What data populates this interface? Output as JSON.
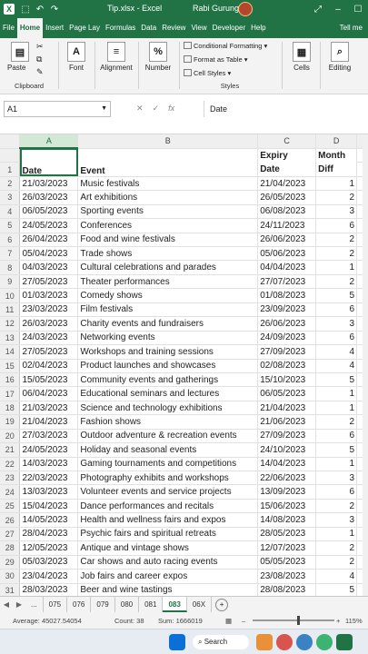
{
  "titlebar": {
    "autosave": "⬚",
    "undo": "↶",
    "redo": "↷",
    "title": "Tip.xlsx  -  Excel",
    "user": "Rabi Gurung",
    "controls": [
      "⤢",
      "–",
      "☐"
    ]
  },
  "tabs": [
    "File",
    "Home",
    "Insert",
    "Page Lay",
    "Formulas",
    "Data",
    "Review",
    "View",
    "Developer",
    "Help"
  ],
  "tellme": "Tell me",
  "ribbon": {
    "clipboard": {
      "paste": "Paste",
      "group": "Clipboard"
    },
    "font": "Font",
    "alignment": "Alignment",
    "number": "Number",
    "styles": {
      "cf": "Conditional Formatting",
      "ft": "Format as Table",
      "cs": "Cell Styles",
      "group": "Styles"
    },
    "cells": "Cells",
    "editing": "Editing"
  },
  "formula_bar": {
    "namebox": "A1",
    "fx": "fx",
    "content": "Date"
  },
  "columns": [
    "A",
    "B",
    "C",
    "D"
  ],
  "header_top": {
    "c": "Expiry",
    "d": "Month"
  },
  "header": {
    "a": "Date",
    "b": "Event",
    "c": "Date",
    "d": "Diff"
  },
  "rows": [
    [
      "21/03/2023",
      "Music festivals",
      "21/04/2023",
      "1"
    ],
    [
      "26/03/2023",
      "Art exhibitions",
      "26/05/2023",
      "2"
    ],
    [
      "06/05/2023",
      "Sporting events",
      "06/08/2023",
      "3"
    ],
    [
      "24/05/2023",
      "Conferences",
      "24/11/2023",
      "6"
    ],
    [
      "26/04/2023",
      "Food and wine festivals",
      "26/06/2023",
      "2"
    ],
    [
      "05/04/2023",
      "Trade shows",
      "05/06/2023",
      "2"
    ],
    [
      "04/03/2023",
      "Cultural celebrations and parades",
      "04/04/2023",
      "1"
    ],
    [
      "27/05/2023",
      "Theater performances",
      "27/07/2023",
      "2"
    ],
    [
      "01/03/2023",
      "Comedy shows",
      "01/08/2023",
      "5"
    ],
    [
      "23/03/2023",
      "Film festivals",
      "23/09/2023",
      "6"
    ],
    [
      "26/03/2023",
      "Charity events and fundraisers",
      "26/06/2023",
      "3"
    ],
    [
      "24/03/2023",
      "Networking events",
      "24/09/2023",
      "6"
    ],
    [
      "27/05/2023",
      "Workshops and training sessions",
      "27/09/2023",
      "4"
    ],
    [
      "02/04/2023",
      "Product launches and showcases",
      "02/08/2023",
      "4"
    ],
    [
      "15/05/2023",
      "Community events and gatherings",
      "15/10/2023",
      "5"
    ],
    [
      "06/04/2023",
      "Educational seminars and lectures",
      "06/05/2023",
      "1"
    ],
    [
      "21/03/2023",
      "Science and technology exhibitions",
      "21/04/2023",
      "1"
    ],
    [
      "21/04/2023",
      "Fashion shows",
      "21/06/2023",
      "2"
    ],
    [
      "27/03/2023",
      "Outdoor adventure & recreation events",
      "27/09/2023",
      "6"
    ],
    [
      "24/05/2023",
      "Holiday and seasonal events",
      "24/10/2023",
      "5"
    ],
    [
      "14/03/2023",
      "Gaming tournaments and competitions",
      "14/04/2023",
      "1"
    ],
    [
      "22/03/2023",
      "Photography exhibits and workshops",
      "22/06/2023",
      "3"
    ],
    [
      "13/03/2023",
      "Volunteer events and service projects",
      "13/09/2023",
      "6"
    ],
    [
      "15/04/2023",
      "Dance performances and recitals",
      "15/06/2023",
      "2"
    ],
    [
      "14/05/2023",
      "Health and wellness fairs and expos",
      "14/08/2023",
      "3"
    ],
    [
      "28/04/2023",
      "Psychic fairs and spiritual retreats",
      "28/05/2023",
      "1"
    ],
    [
      "12/05/2023",
      "Antique and vintage shows",
      "12/07/2023",
      "2"
    ],
    [
      "05/03/2023",
      "Car shows and auto racing events",
      "05/05/2023",
      "2"
    ],
    [
      "23/04/2023",
      "Job fairs and career expos",
      "23/08/2023",
      "4"
    ],
    [
      "28/03/2023",
      "Beer and wine tastings",
      "28/08/2023",
      "5"
    ]
  ],
  "sheet_tabs": [
    "...",
    "075",
    "076",
    "079",
    "080",
    "081",
    "083",
    "06X"
  ],
  "active_sheet": "083",
  "status": {
    "average": "Average: 45027.54054",
    "count": "Count: 38",
    "sum": "Sum: 1666019",
    "zoom": "115%"
  },
  "taskbar": {
    "search": "Search"
  }
}
